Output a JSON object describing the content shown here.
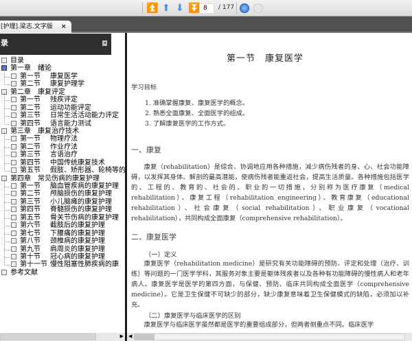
{
  "toolbar": {
    "first_page_icon": "first-page-icon",
    "prev_icon": "arrow-up-icon",
    "next_icon": "arrow-down-icon",
    "last_icon": "last-page-icon",
    "page": "8",
    "total": "/ 177"
  },
  "tab": {
    "title": "[护理].梁志.文字版",
    "close": "×"
  },
  "sidebar": {
    "title": "录",
    "collapse": "◂",
    "items": [
      {
        "num": "目录",
        "label": "",
        "level": 0
      },
      {
        "num": "第一章",
        "label": "绪论",
        "level": 0,
        "selected": true
      },
      {
        "num": "第一节",
        "label": "康复医学",
        "level": 1
      },
      {
        "num": "第二节",
        "label": "康复护理学",
        "level": 1
      },
      {
        "num": "第二章",
        "label": "康复评定",
        "level": 0
      },
      {
        "num": "第一节",
        "label": "残疾评定",
        "level": 1
      },
      {
        "num": "第二节",
        "label": "运动功能评定",
        "level": 1
      },
      {
        "num": "第三节",
        "label": "日常生活活动能力评定",
        "level": 1
      },
      {
        "num": "第四节",
        "label": "语言能力测试",
        "level": 1
      },
      {
        "num": "第三章",
        "label": "康复治疗技术",
        "level": 0
      },
      {
        "num": "第一节",
        "label": "物理疗法",
        "level": 1
      },
      {
        "num": "第二节",
        "label": "作业疗法",
        "level": 1
      },
      {
        "num": "第三节",
        "label": "言语治疗",
        "level": 1
      },
      {
        "num": "第四节",
        "label": "中国传统康复技术",
        "level": 1
      },
      {
        "num": "第五节",
        "label": "假肢、矫形器、轮椅等的",
        "level": 1
      },
      {
        "num": "第四章",
        "label": "常见伤病的康复护理",
        "level": 0
      },
      {
        "num": "第一节",
        "label": "脑血管疾病的康复护理",
        "level": 1
      },
      {
        "num": "第二节",
        "label": "颅脑损伤的康复护理",
        "level": 1
      },
      {
        "num": "第三节",
        "label": "小儿脑瘫的康复护理",
        "level": 1
      },
      {
        "num": "第四节",
        "label": "脊髓损伤的康复护理",
        "level": 1
      },
      {
        "num": "第五节",
        "label": "骨关节伤病的康复护理",
        "level": 1
      },
      {
        "num": "第六节",
        "label": "截肢后的康复护理",
        "level": 1
      },
      {
        "num": "第七节",
        "label": "下腰痛的康复护理",
        "level": 1
      },
      {
        "num": "第八节",
        "label": "颈椎病的康复护理",
        "level": 1
      },
      {
        "num": "第九节",
        "label": "肩周炎的康复护理",
        "level": 1
      },
      {
        "num": "第十节",
        "label": "冠心病的康复护理",
        "level": 1
      },
      {
        "num": "第十一节",
        "label": "慢性阻塞性肺疾病的康",
        "level": 1
      },
      {
        "num": "参考文献",
        "label": "",
        "level": 0
      }
    ]
  },
  "document": {
    "title": "第一节　康复医学",
    "objectives_heading": "学习目标",
    "objectives": [
      "1. 准确掌握康复、康复医学的概念。",
      "2. 熟悉全面康复、全面医学的组成。",
      "3. 了解康复医学的工作方式。"
    ],
    "section1_heading": "一、康复",
    "section1_para": "康复（rehabilitation）是综合、协调地应用各种措施，减少病伤残者的身、心、社会功能障碍，以发挥其身体、解剖的最高潜能，使病伤残者能重返社会，提高生活质量。各种措施包括医学的、工程的、教育的、社会的、职业的一切措施，分别称为医疗康复（medical rehabilitation）、康复工程（rehabilitation engineering）、教育康复（educational rehabilitation）、社会康复（social rehabilitation）、职业康复（vocational rehabilitation），共同构成全面康复（comprehensive rehabilitation）。",
    "section2_heading": "二、康复医学",
    "sub1_heading": "（一）定义",
    "sub1_para": "康复医学（rehabilitation medicine）是研究有关功能障碍的预防、评定和处理（治疗、训练）等问题的一门医学学科，其服务对象主要是躯体残疾者以及各种有功能障碍的慢性病人和老年病人。康复医学是医学的第四方面，与保健、预防、临床共同构成全面医学（comprehensive medicine）。它是卫生保健不可缺少的部分，缺少康复意味着卫生保健模式的缺陷，必须加以补充。",
    "sub2_heading": "（二）康复医学与临床医学的区别",
    "sub2_para": "康复医学与临床医学虽然都是医学的重要组成部分，但两者侧重点不同。临床医学"
  }
}
